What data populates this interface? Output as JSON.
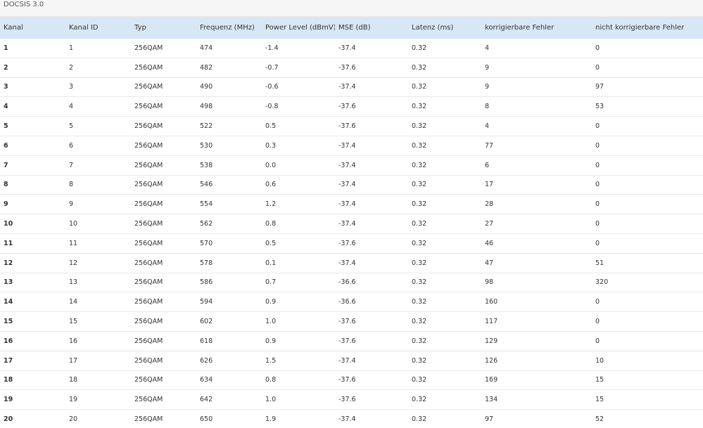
{
  "section": {
    "title": "DOCSIS 3.0"
  },
  "table": {
    "headers": [
      "Kanal",
      "Kanal ID",
      "Typ",
      "Frequenz (MHz)",
      "Power Level (dBmV)",
      "MSE (dB)",
      "Latenz (ms)",
      "korrigierbare Fehler",
      "nicht korrigierbare Fehler"
    ],
    "rows": [
      [
        "1",
        "1",
        "256QAM",
        "474",
        "-1.4",
        "-37.4",
        "0.32",
        "4",
        "0"
      ],
      [
        "2",
        "2",
        "256QAM",
        "482",
        "-0.7",
        "-37.6",
        "0.32",
        "9",
        "0"
      ],
      [
        "3",
        "3",
        "256QAM",
        "490",
        "-0.6",
        "-37.4",
        "0.32",
        "9",
        "97"
      ],
      [
        "4",
        "4",
        "256QAM",
        "498",
        "-0.8",
        "-37.6",
        "0.32",
        "8",
        "53"
      ],
      [
        "5",
        "5",
        "256QAM",
        "522",
        "0.5",
        "-37.6",
        "0.32",
        "4",
        "0"
      ],
      [
        "6",
        "6",
        "256QAM",
        "530",
        "0.3",
        "-37.4",
        "0.32",
        "77",
        "0"
      ],
      [
        "7",
        "7",
        "256QAM",
        "538",
        "0.0",
        "-37.4",
        "0.32",
        "6",
        "0"
      ],
      [
        "8",
        "8",
        "256QAM",
        "546",
        "0.6",
        "-37.4",
        "0.32",
        "17",
        "0"
      ],
      [
        "9",
        "9",
        "256QAM",
        "554",
        "1.2",
        "-37.4",
        "0.32",
        "28",
        "0"
      ],
      [
        "10",
        "10",
        "256QAM",
        "562",
        "0.8",
        "-37.4",
        "0.32",
        "27",
        "0"
      ],
      [
        "11",
        "11",
        "256QAM",
        "570",
        "0.5",
        "-37.6",
        "0.32",
        "46",
        "0"
      ],
      [
        "12",
        "12",
        "256QAM",
        "578",
        "0.1",
        "-37.4",
        "0.32",
        "47",
        "51"
      ],
      [
        "13",
        "13",
        "256QAM",
        "586",
        "0.7",
        "-36.6",
        "0.32",
        "98",
        "320"
      ],
      [
        "14",
        "14",
        "256QAM",
        "594",
        "0.9",
        "-36.6",
        "0.32",
        "160",
        "0"
      ],
      [
        "15",
        "15",
        "256QAM",
        "602",
        "1.0",
        "-37.6",
        "0.32",
        "117",
        "0"
      ],
      [
        "16",
        "16",
        "256QAM",
        "618",
        "0.9",
        "-37.6",
        "0.32",
        "129",
        "0"
      ],
      [
        "17",
        "17",
        "256QAM",
        "626",
        "1.5",
        "-37.4",
        "0.32",
        "126",
        "10"
      ],
      [
        "18",
        "18",
        "256QAM",
        "634",
        "0.8",
        "-37.6",
        "0.32",
        "169",
        "15"
      ],
      [
        "19",
        "19",
        "256QAM",
        "642",
        "1.0",
        "-37.6",
        "0.32",
        "134",
        "15"
      ],
      [
        "20",
        "20",
        "256QAM",
        "650",
        "1.9",
        "-37.4",
        "0.32",
        "97",
        "52"
      ]
    ]
  }
}
